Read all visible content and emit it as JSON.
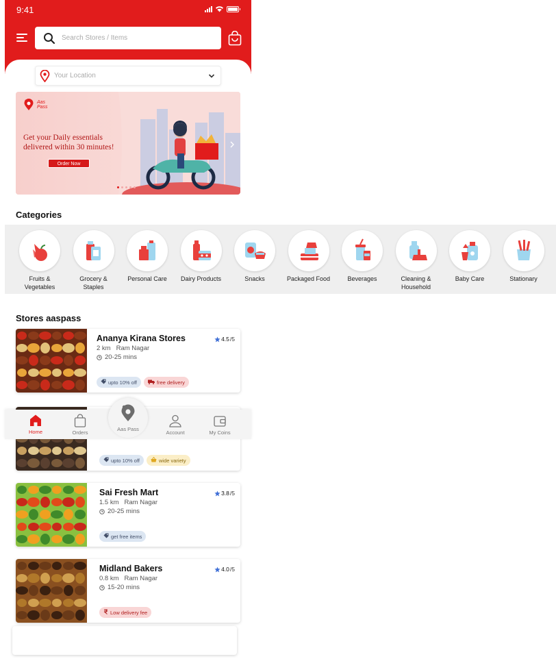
{
  "status": {
    "time": "9:41"
  },
  "search": {
    "placeholder": "Search Stores / Items"
  },
  "location": {
    "placeholder": "Your Location"
  },
  "banner": {
    "logo_text": "Aas Pass",
    "headline": "Get your Daily essentials delivered within 30 minutes!",
    "cta": "Order Now",
    "slides": 5,
    "active_slide": 1
  },
  "categories": {
    "title": "Categories",
    "items": [
      {
        "label": "Fruits & Vegetables",
        "icon": "fruits-icon"
      },
      {
        "label": "Grocery & Staples",
        "icon": "grocery-icon"
      },
      {
        "label": "Personal Care",
        "icon": "personal-care-icon"
      },
      {
        "label": "Dairy Products",
        "icon": "dairy-icon"
      },
      {
        "label": "Snacks",
        "icon": "snacks-icon"
      },
      {
        "label": "Packaged Food",
        "icon": "packaged-food-icon"
      },
      {
        "label": "Beverages",
        "icon": "beverages-icon"
      },
      {
        "label": "Cleaning & Household",
        "icon": "cleaning-icon"
      },
      {
        "label": "Baby Care",
        "icon": "baby-care-icon"
      },
      {
        "label": "Stationary",
        "icon": "stationary-icon"
      }
    ]
  },
  "stores": {
    "title": "Stores aaspass",
    "items": [
      {
        "name": "Ananya Kirana Stores",
        "rating": "4.5",
        "rating_max": "/5",
        "distance": "2 km",
        "area": "Ram Nagar",
        "time": "20-25 mins",
        "tags": [
          {
            "text": "upto 10% off",
            "style": "blue",
            "icon": "discount-tag-icon"
          },
          {
            "text": "free delivery",
            "style": "red",
            "icon": "truck-icon"
          }
        ]
      },
      {
        "name": "",
        "rating": "",
        "rating_max": "",
        "distance": "",
        "area": "",
        "time": "",
        "tags": [
          {
            "text": "upto 10% off",
            "style": "blue",
            "icon": "discount-tag-icon"
          },
          {
            "text": "wide variety",
            "style": "yellow",
            "icon": "basket-icon"
          }
        ]
      },
      {
        "name": "Sai Fresh Mart",
        "rating": "3.8",
        "rating_max": "/5",
        "distance": "1.5 km",
        "area": "Ram Nagar",
        "time": "20-25 mins",
        "tags": [
          {
            "text": "get free items",
            "style": "blue",
            "icon": "discount-tag-icon"
          }
        ]
      },
      {
        "name": "Midland Bakers",
        "rating": "4.0",
        "rating_max": "/5",
        "distance": "0.8 km",
        "area": "Ram Nagar",
        "time": "15-20 mins",
        "tags": [
          {
            "text": "Low delivery fee",
            "style": "red",
            "icon": "rupee-icon"
          }
        ]
      }
    ]
  },
  "nav": {
    "home": "Home",
    "orders": "Orders",
    "aaspass": "Aas Pass",
    "account": "Account",
    "coins": "My Coins"
  },
  "colors": {
    "brand": "#e11c1c",
    "star": "#3f6fd6"
  }
}
